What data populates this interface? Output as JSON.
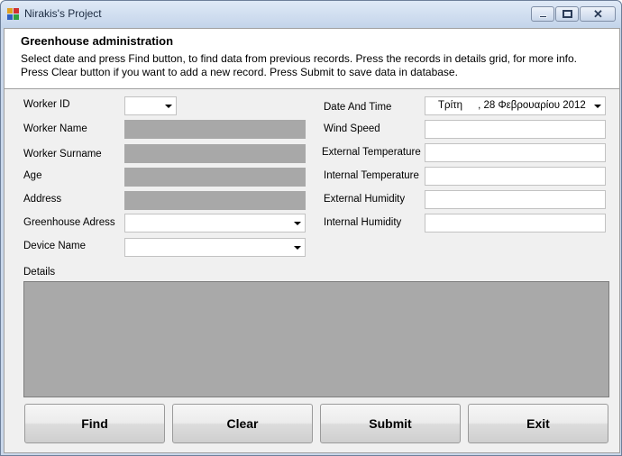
{
  "window": {
    "title": "Nirakis's Project"
  },
  "header": {
    "title": "Greenhouse administration",
    "description": "Select date and press Find button, to find data from previous records. Press the records in details grid, for more info. Press Clear button if you want to add a new record. Press Submit to save data in database."
  },
  "left_form": {
    "worker_id_label": "Worker ID",
    "worker_id_value": "",
    "worker_name_label": "Worker Name",
    "worker_surname_label": "Worker Surname",
    "age_label": "Age",
    "address_label": "Address",
    "greenhouse_address_label": "Greenhouse Adress",
    "greenhouse_address_value": "",
    "device_name_label": "Device Name",
    "device_name_value": ""
  },
  "right_form": {
    "date_time_label": "Date And Time",
    "date_day": "Τρίτη",
    "date_rest": ", 28 Φεβρουαρίου 2012",
    "wind_speed_label": "Wind Speed",
    "external_temperature_label": "External Temperature",
    "internal_temperature_label": "Internal Temperature",
    "external_humidity_label": "External Humidity",
    "internal_humidity_label": "Internal Humidity"
  },
  "details": {
    "label": "Details"
  },
  "buttons": {
    "find": "Find",
    "clear": "Clear",
    "submit": "Submit",
    "exit": "Exit"
  },
  "colors": {
    "disabled_field": "#a8a8a8",
    "grid_background": "#a9a9a9",
    "client_background": "#f0f0f0"
  }
}
